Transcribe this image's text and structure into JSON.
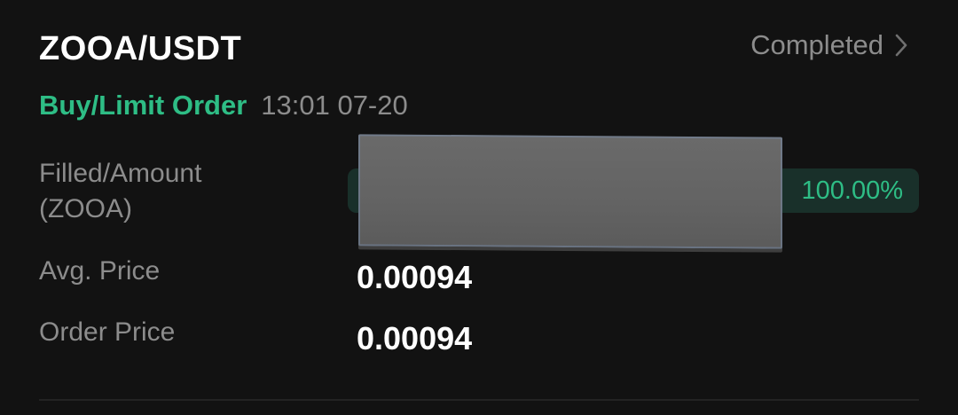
{
  "order": {
    "pair": "ZOOA/USDT",
    "status": "Completed",
    "side_type": "Buy/Limit Order",
    "time": "13:01 07-20",
    "filled_label_line1": "Filled/Amount",
    "filled_label_line2": "(ZOOA)",
    "fill_percent_text": "100.00%",
    "fill_fraction": 1.0,
    "avg_price_label": "Avg. Price",
    "avg_price": "0.00094",
    "order_price_label": "Order Price",
    "order_price": "0.00094"
  },
  "colors": {
    "background": "#121212",
    "accent_green": "#2ebd85",
    "muted_text": "#8c8c8c",
    "primary_text": "#ffffff"
  },
  "icons": {
    "status_arrow": "chevron-right-icon"
  }
}
